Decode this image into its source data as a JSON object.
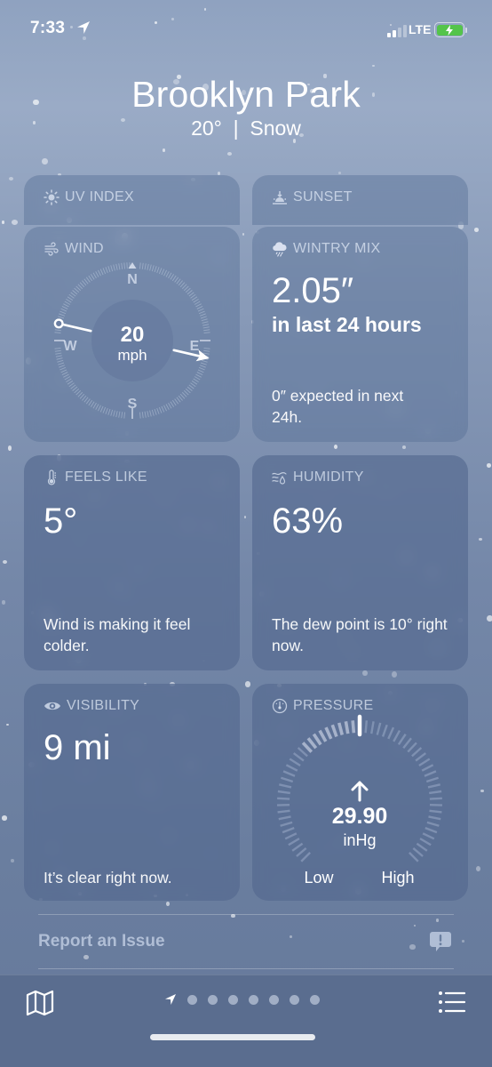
{
  "status_bar": {
    "time": "7:33",
    "location_icon": "location-arrow-icon",
    "signal_bars_filled": 2,
    "signal_bars_total": 4,
    "network": "LTE",
    "battery_icon": "battery-charging-icon",
    "battery_color": "#54c44a"
  },
  "header": {
    "city": "Brooklyn Park",
    "condition": "20°  |  Snow"
  },
  "cards": {
    "uv_index": {
      "title": "UV INDEX",
      "icon": "sun-icon"
    },
    "sunset": {
      "title": "SUNSET",
      "icon": "sunset-icon"
    },
    "wind": {
      "title": "WIND",
      "icon": "wind-icon",
      "speed": "20",
      "unit": "mph",
      "direction_degrees": 283,
      "compass_labels": {
        "n": "N",
        "e": "E",
        "s": "S",
        "w": "W"
      }
    },
    "wintry_mix": {
      "title": "WINTRY MIX",
      "icon": "cloud-rain-icon",
      "value": "2.05″",
      "period": "in last 24 hours",
      "description": "0″ expected in next 24h."
    },
    "feels_like": {
      "title": "FEELS LIKE",
      "icon": "thermometer-icon",
      "value": "5°",
      "description": "Wind is making it feel colder."
    },
    "humidity": {
      "title": "HUMIDITY",
      "icon": "humidity-icon",
      "value": "63%",
      "description": "The dew point is 10° right now."
    },
    "visibility": {
      "title": "VISIBILITY",
      "icon": "eye-icon",
      "value": "9 mi",
      "description": "It’s clear right now."
    },
    "pressure": {
      "title": "PRESSURE",
      "icon": "gauge-icon",
      "trend_icon": "arrow-up-icon",
      "value": "29.90",
      "unit": "inHg",
      "gauge_fraction": 0.5,
      "low_label": "Low",
      "high_label": "High"
    }
  },
  "report": {
    "label": "Report an Issue",
    "icon": "report-bubble-icon"
  },
  "bottom_bar": {
    "map_icon": "map-icon",
    "list_icon": "list-icon",
    "page_count": 7,
    "current_page": "location"
  },
  "colors": {
    "background": "#7a8cac",
    "bottom_bar": "#5a6d8f",
    "card": "#5a7096"
  }
}
